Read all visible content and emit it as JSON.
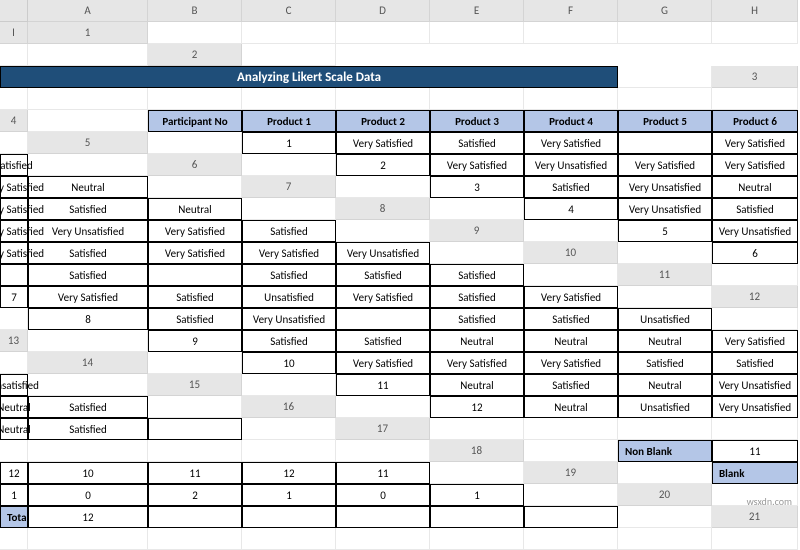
{
  "cols": [
    "A",
    "B",
    "C",
    "D",
    "E",
    "F",
    "G",
    "H",
    "I"
  ],
  "title": "Analyzing Likert Scale Data",
  "headers": [
    "Participant No",
    "Product 1",
    "Product 2",
    "Product 3",
    "Product 4",
    "Product 5",
    "Product 6"
  ],
  "rows": [
    {
      "n": "1",
      "v": [
        "Very Satisfied",
        "Satisfied",
        "Very Satisfied",
        "",
        "Very Satisfied",
        "Satisfied"
      ]
    },
    {
      "n": "2",
      "v": [
        "Very Satisfied",
        "Very Unsatisfied",
        "Very Satisfied",
        "Very Satisfied",
        "Very Satisfied",
        "Neutral"
      ]
    },
    {
      "n": "3",
      "v": [
        "Satisfied",
        "Very Unsatisfied",
        "Neutral",
        "Very Satisfied",
        "Satisfied",
        "Neutral"
      ]
    },
    {
      "n": "4",
      "v": [
        "Very Unsatisfied",
        "Satisfied",
        "Very Satisfied",
        "Very Unsatisfied",
        "Very Satisfied",
        "Satisfied"
      ]
    },
    {
      "n": "5",
      "v": [
        "Very Unsatisfied",
        "Very Satisfied",
        "Satisfied",
        "Very Satisfied",
        "Very Satisfied",
        "Very Unsatisfied"
      ]
    },
    {
      "n": "6",
      "v": [
        "",
        "Satisfied",
        "",
        "Satisfied",
        "Satisfied",
        "Satisfied"
      ]
    },
    {
      "n": "7",
      "v": [
        "Very Satisfied",
        "Satisfied",
        "Unsatisfied",
        "Very Satisfied",
        "Satisfied",
        "Very Satisfied"
      ]
    },
    {
      "n": "8",
      "v": [
        "Satisfied",
        "Very Unsatisfied",
        "",
        "Satisfied",
        "Satisfied",
        "Unsatisfied"
      ]
    },
    {
      "n": "9",
      "v": [
        "Satisfied",
        "Satisfied",
        "Neutral",
        "Neutral",
        "Neutral",
        "Very Satisfied"
      ]
    },
    {
      "n": "10",
      "v": [
        "Very Satisfied",
        "Very Satisfied",
        "Very Satisfied",
        "Satisfied",
        "Satisfied",
        "Unsatisfied"
      ]
    },
    {
      "n": "11",
      "v": [
        "Neutral",
        "Satisfied",
        "Neutral",
        "Very Unsatisfied",
        "Neutral",
        "Satisfied"
      ]
    },
    {
      "n": "12",
      "v": [
        "Neutral",
        "Unsatisfied",
        "Very Unsatisfied",
        "Neutral",
        "Satisfied",
        ""
      ]
    }
  ],
  "summary": [
    {
      "label": "Non Blank",
      "v": [
        "11",
        "12",
        "10",
        "11",
        "12",
        "11"
      ]
    },
    {
      "label": "Blank",
      "v": [
        "1",
        "0",
        "2",
        "1",
        "0",
        "1"
      ]
    },
    {
      "label": "Total",
      "v": [
        "12",
        "",
        "",
        "",
        "",
        ""
      ]
    }
  ],
  "rownums_visible": [
    "1",
    "2",
    "3",
    "4",
    "5",
    "6",
    "7",
    "8",
    "9",
    "10",
    "11",
    "12",
    "13",
    "14",
    "15",
    "16",
    "17",
    "18",
    "19",
    "20",
    "21"
  ],
  "watermark": "wsxdn.com"
}
